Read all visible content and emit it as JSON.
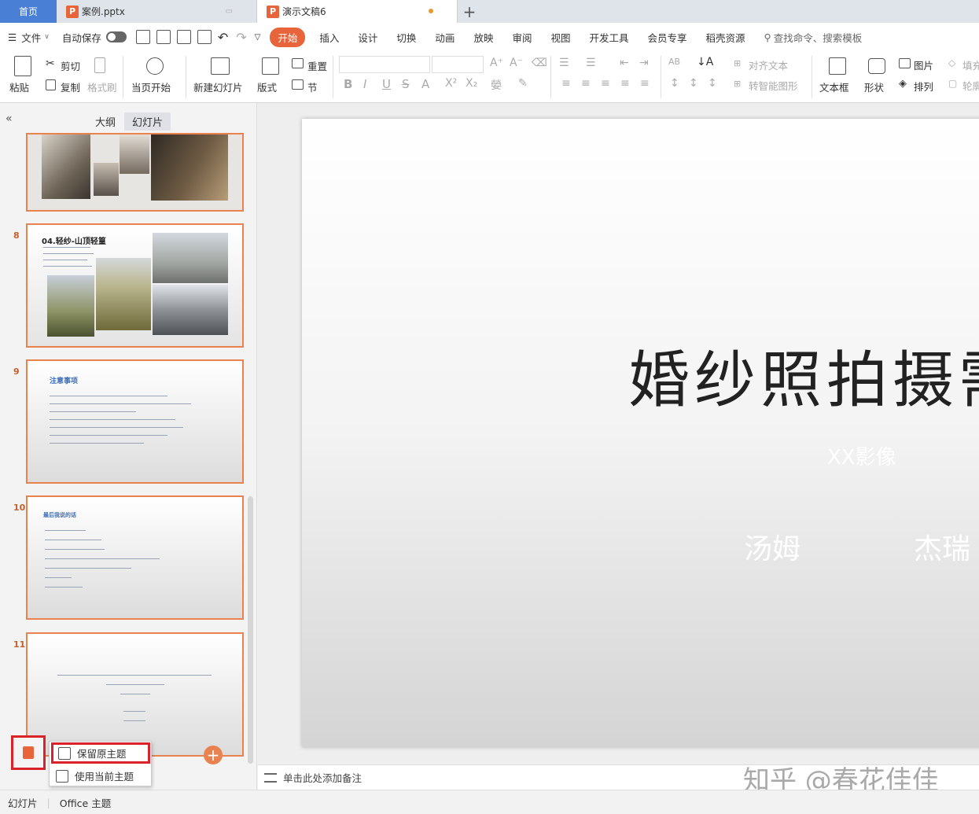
{
  "tabs": {
    "home": "首页",
    "file1": "案例.pptx",
    "file2": "演示文稿6"
  },
  "menu": {
    "file": "文件",
    "autosave": "自动保存",
    "items": [
      "开始",
      "插入",
      "设计",
      "切换",
      "动画",
      "放映",
      "审阅",
      "视图",
      "开发工具",
      "会员专享",
      "稻壳资源"
    ],
    "search": "查找命令、搜索模板"
  },
  "ribbon": {
    "paste": "粘贴",
    "cut": "剪切",
    "copy": "复制",
    "format_painter": "格式刷",
    "from_current": "当页开始",
    "new_slide": "新建幻灯片",
    "layout": "版式",
    "reset": "重置",
    "section": "节",
    "align_text": "对齐文本",
    "smart_shape": "转智能图形",
    "textbox": "文本框",
    "shape": "形状",
    "picture": "图片",
    "arrange": "排列",
    "fill": "填充",
    "outline": "轮廓"
  },
  "left_panel": {
    "tab_outline": "大纲",
    "tab_slides": "幻灯片",
    "slides": [
      {
        "num": "8",
        "title": "04.轻纱-山顶轻篁"
      },
      {
        "num": "9",
        "title": "注意事项"
      },
      {
        "num": "10",
        "title": "最后我说的话"
      },
      {
        "num": "11"
      }
    ]
  },
  "slide": {
    "title": "婚纱照拍摄需",
    "subtitle": "XX影像",
    "name1": "汤姆",
    "name2": "杰瑞"
  },
  "notes": {
    "placeholder": "单击此处添加备注"
  },
  "watermark": "知乎 @春花佳佳",
  "paste_options": {
    "keep_original": "保留原主题",
    "use_current": "使用当前主题"
  },
  "status": {
    "view": "幻灯片",
    "theme": "Office 主题"
  },
  "colors": {
    "accent": "#e8643a",
    "thumb_border": "#e8824f",
    "highlight": "#d9222a",
    "home_tab": "#4a7fd6"
  }
}
